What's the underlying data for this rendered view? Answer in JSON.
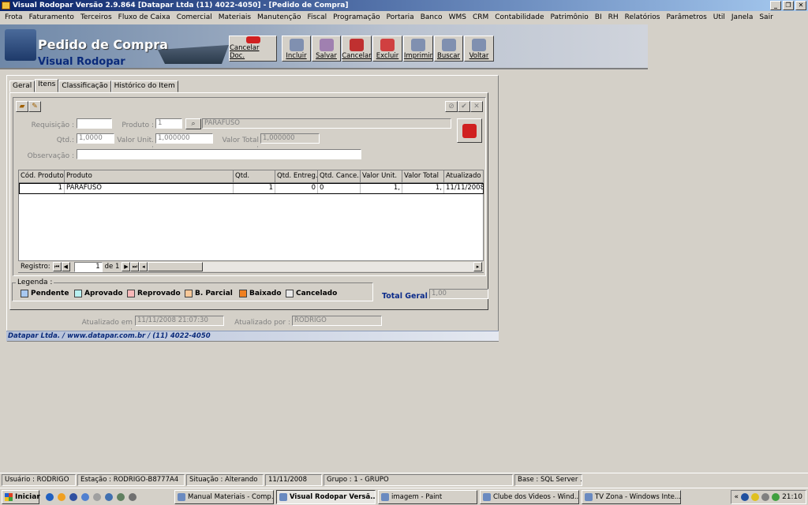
{
  "window": {
    "title": "Visual Rodopar Versão 2.9.864 [Datapar Ltda (11) 4022-4050] - [Pedido de Compra]",
    "buttons": [
      "_",
      "❐",
      "✕"
    ]
  },
  "menu": [
    "Frota",
    "Faturamento",
    "Terceiros",
    "Fluxo de Caixa",
    "Comercial",
    "Materiais",
    "Manutenção",
    "Fiscal",
    "Programação",
    "Portaria",
    "Banco",
    "WMS",
    "CRM",
    "Contabilidade",
    "Patrimônio",
    "BI",
    "RH",
    "Relatórios",
    "Parâmetros",
    "Util",
    "Janela",
    "Sair"
  ],
  "header": {
    "title": "Pedido de Compra",
    "subtitle": "Visual Rodopar"
  },
  "toolbar": {
    "cancel_doc": "Cancelar Doc.",
    "include": "Incluir",
    "save": "Salvar",
    "cancel": "Cancelar",
    "delete": "Excluir",
    "print": "Imprimir",
    "search": "Buscar",
    "back": "Voltar"
  },
  "tabs": [
    "Geral",
    "Itens",
    "Classificação",
    "Histórico do Item"
  ],
  "form": {
    "requisicao_label": "Requisição :",
    "requisicao_value": "",
    "produto_label": "Produto :",
    "produto_code": "1",
    "produto_name": "PARAFUSO",
    "qtd_label": "Qtd.:",
    "qtd_value": "1,0000",
    "valor_unit_label": "Valor Unit. :",
    "valor_unit_value": "1,000000",
    "valor_total_label": "Valor Total :",
    "valor_total_value": "1,000000",
    "observacao_label": "Observação :",
    "observacao_value": ""
  },
  "grid": {
    "columns": [
      "Cód. Produto",
      "Produto",
      "Qtd.",
      "Qtd. Entreg...",
      "Qtd. Cance...",
      "Valor Unit.",
      "Valor Total",
      "Atualizado e"
    ],
    "rows": [
      [
        "1",
        "PARAFUSO",
        "1",
        "0",
        "0",
        "1,",
        "1,",
        "11/11/2008"
      ]
    ]
  },
  "navigator": {
    "label": "Registro:",
    "current": "1",
    "of": "de 1"
  },
  "legend": {
    "title": "Legenda :",
    "items": [
      {
        "label": "Pendente",
        "color": "#a8c8f0"
      },
      {
        "label": "Aprovado",
        "color": "#b8f0f0"
      },
      {
        "label": "Reprovado",
        "color": "#f8b8b8"
      },
      {
        "label": "B. Parcial",
        "color": "#f8c898"
      },
      {
        "label": "Baixado",
        "color": "#f08020"
      },
      {
        "label": "Cancelado",
        "color": "#e8e8e8"
      }
    ]
  },
  "total": {
    "label": "Total Geral :",
    "value": "1,00"
  },
  "audit": {
    "updated_at_label": "Atualizado em :",
    "updated_at": "11/11/2008 21:07:30",
    "updated_by_label": "Atualizado por :",
    "updated_by": "RODRIGO"
  },
  "footer": "Datapar Ltda.   /   www.datapar.com.br   /   (11) 4022-4050",
  "status": {
    "user": "Usuário : RODRIGO",
    "station": "Estação : RODRIGO-B8777A4",
    "situation": "Situação : Alterando",
    "date": "11/11/2008",
    "group": "Grupo : 1 - GRUPO",
    "base": "Base : SQL Server ..."
  },
  "taskbar": {
    "start": "Iniciar",
    "tasks": [
      "Manual Materiais - Comp...",
      "Visual Rodopar Versã...",
      "imagem - Paint",
      "Clube dos Videos - Wind...",
      "TV Zona - Windows Inte..."
    ],
    "clock": "21:10"
  }
}
